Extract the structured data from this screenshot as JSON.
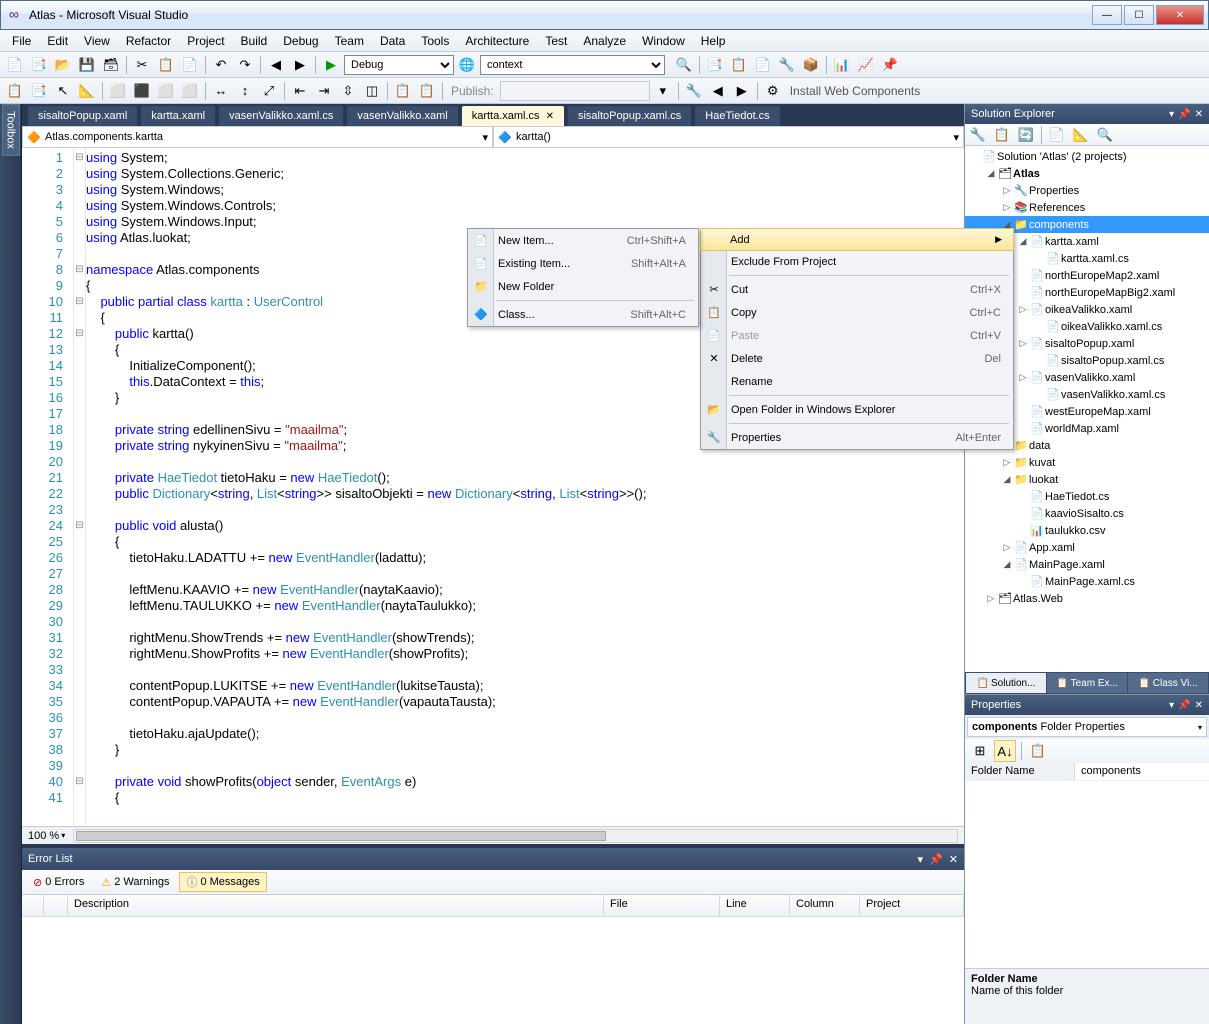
{
  "title": "Atlas - Microsoft Visual Studio",
  "menubar": [
    "File",
    "Edit",
    "View",
    "Refactor",
    "Project",
    "Build",
    "Debug",
    "Team",
    "Data",
    "Tools",
    "Architecture",
    "Test",
    "Analyze",
    "Window",
    "Help"
  ],
  "toolbar1": {
    "debug_config": "Debug",
    "context": "context"
  },
  "toolbar2": {
    "publish_label": "Publish:",
    "install_label": "Install Web Components"
  },
  "left_tab": "Toolbox",
  "doc_tabs": [
    {
      "label": "sisaltoPopup.xaml",
      "active": false
    },
    {
      "label": "kartta.xaml",
      "active": false
    },
    {
      "label": "vasenValikko.xaml.cs",
      "active": false
    },
    {
      "label": "vasenValikko.xaml",
      "active": false
    },
    {
      "label": "kartta.xaml.cs",
      "active": true
    },
    {
      "label": "sisaltoPopup.xaml.cs",
      "active": false
    },
    {
      "label": "HaeTiedot.cs",
      "active": false
    }
  ],
  "nav": {
    "left": "Atlas.components.kartta",
    "right": "kartta()"
  },
  "zoom": "100 %",
  "code_lines": [
    {
      "n": 1,
      "o": "⊟",
      "t": [
        [
          "kw",
          "using"
        ],
        [
          "",
          " System;"
        ]
      ]
    },
    {
      "n": 2,
      "o": "",
      "t": [
        [
          "kw",
          "using"
        ],
        [
          "",
          " System.Collections.Generic;"
        ]
      ]
    },
    {
      "n": 3,
      "o": "",
      "t": [
        [
          "kw",
          "using"
        ],
        [
          "",
          " System.Windows;"
        ]
      ]
    },
    {
      "n": 4,
      "o": "",
      "t": [
        [
          "kw",
          "using"
        ],
        [
          "",
          " System.Windows.Controls;"
        ]
      ]
    },
    {
      "n": 5,
      "o": "",
      "t": [
        [
          "kw",
          "using"
        ],
        [
          "",
          " System.Windows.Input;"
        ]
      ]
    },
    {
      "n": 6,
      "o": "",
      "t": [
        [
          "kw",
          "using"
        ],
        [
          "",
          " Atlas.luokat;"
        ]
      ]
    },
    {
      "n": 7,
      "o": "",
      "t": [
        [
          "",
          ""
        ]
      ]
    },
    {
      "n": 8,
      "o": "⊟",
      "t": [
        [
          "kw",
          "namespace"
        ],
        [
          "",
          " Atlas.components"
        ]
      ]
    },
    {
      "n": 9,
      "o": "",
      "t": [
        [
          "",
          "{"
        ]
      ]
    },
    {
      "n": 10,
      "o": "⊟",
      "t": [
        [
          "",
          "    "
        ],
        [
          "kw",
          "public"
        ],
        [
          "",
          " "
        ],
        [
          "kw",
          "partial"
        ],
        [
          "",
          " "
        ],
        [
          "kw",
          "class"
        ],
        [
          "",
          " "
        ],
        [
          "type",
          "kartta"
        ],
        [
          "",
          " : "
        ],
        [
          "type",
          "UserControl"
        ]
      ]
    },
    {
      "n": 11,
      "o": "",
      "t": [
        [
          "",
          "    {"
        ]
      ]
    },
    {
      "n": 12,
      "o": "⊟",
      "t": [
        [
          "",
          "        "
        ],
        [
          "kw",
          "public"
        ],
        [
          "",
          " kartta()"
        ]
      ]
    },
    {
      "n": 13,
      "o": "",
      "t": [
        [
          "",
          "        {"
        ]
      ]
    },
    {
      "n": 14,
      "o": "",
      "t": [
        [
          "",
          "            InitializeComponent();"
        ]
      ]
    },
    {
      "n": 15,
      "o": "",
      "t": [
        [
          "",
          "            "
        ],
        [
          "kw",
          "this"
        ],
        [
          "",
          ".DataContext = "
        ],
        [
          "kw",
          "this"
        ],
        [
          "",
          ";"
        ]
      ]
    },
    {
      "n": 16,
      "o": "",
      "t": [
        [
          "",
          "        }"
        ]
      ]
    },
    {
      "n": 17,
      "o": "",
      "t": [
        [
          "",
          ""
        ]
      ]
    },
    {
      "n": 18,
      "o": "",
      "t": [
        [
          "",
          "        "
        ],
        [
          "kw",
          "private"
        ],
        [
          "",
          " "
        ],
        [
          "kw",
          "string"
        ],
        [
          "",
          " edellinenSivu = "
        ],
        [
          "str",
          "\"maailma\""
        ],
        [
          "",
          ";"
        ]
      ]
    },
    {
      "n": 19,
      "o": "",
      "t": [
        [
          "",
          "        "
        ],
        [
          "kw",
          "private"
        ],
        [
          "",
          " "
        ],
        [
          "kw",
          "string"
        ],
        [
          "",
          " nykyinenSivu = "
        ],
        [
          "str",
          "\"maailma\""
        ],
        [
          "",
          ";"
        ]
      ]
    },
    {
      "n": 20,
      "o": "",
      "t": [
        [
          "",
          ""
        ]
      ]
    },
    {
      "n": 21,
      "o": "",
      "t": [
        [
          "",
          "        "
        ],
        [
          "kw",
          "private"
        ],
        [
          "",
          " "
        ],
        [
          "type",
          "HaeTiedot"
        ],
        [
          "",
          " tietoHaku = "
        ],
        [
          "kw",
          "new"
        ],
        [
          "",
          " "
        ],
        [
          "type",
          "HaeTiedot"
        ],
        [
          "",
          "();"
        ]
      ]
    },
    {
      "n": 22,
      "o": "",
      "t": [
        [
          "",
          "        "
        ],
        [
          "kw",
          "public"
        ],
        [
          "",
          " "
        ],
        [
          "type",
          "Dictionary"
        ],
        [
          "",
          "<"
        ],
        [
          "kw",
          "string"
        ],
        [
          "",
          ", "
        ],
        [
          "type",
          "List"
        ],
        [
          "",
          "<"
        ],
        [
          "kw",
          "string"
        ],
        [
          "",
          ">> sisaltoObjekti = "
        ],
        [
          "kw",
          "new"
        ],
        [
          "",
          " "
        ],
        [
          "type",
          "Dictionary"
        ],
        [
          "",
          "<"
        ],
        [
          "kw",
          "string"
        ],
        [
          "",
          ", "
        ],
        [
          "type",
          "List"
        ],
        [
          "",
          "<"
        ],
        [
          "kw",
          "string"
        ],
        [
          "",
          ">>();"
        ]
      ]
    },
    {
      "n": 23,
      "o": "",
      "t": [
        [
          "",
          ""
        ]
      ]
    },
    {
      "n": 24,
      "o": "⊟",
      "t": [
        [
          "",
          "        "
        ],
        [
          "kw",
          "public"
        ],
        [
          "",
          " "
        ],
        [
          "kw",
          "void"
        ],
        [
          "",
          " alusta()"
        ]
      ]
    },
    {
      "n": 25,
      "o": "",
      "t": [
        [
          "",
          "        {"
        ]
      ]
    },
    {
      "n": 26,
      "o": "",
      "t": [
        [
          "",
          "            tietoHaku.LADATTU += "
        ],
        [
          "kw",
          "new"
        ],
        [
          "",
          " "
        ],
        [
          "type",
          "EventHandler"
        ],
        [
          "",
          "(ladattu);"
        ]
      ]
    },
    {
      "n": 27,
      "o": "",
      "t": [
        [
          "",
          ""
        ]
      ]
    },
    {
      "n": 28,
      "o": "",
      "t": [
        [
          "",
          "            leftMenu.KAAVIO += "
        ],
        [
          "kw",
          "new"
        ],
        [
          "",
          " "
        ],
        [
          "type",
          "EventHandler"
        ],
        [
          "",
          "(naytaKaavio);"
        ]
      ]
    },
    {
      "n": 29,
      "o": "",
      "t": [
        [
          "",
          "            leftMenu.TAULUKKO += "
        ],
        [
          "kw",
          "new"
        ],
        [
          "",
          " "
        ],
        [
          "type",
          "EventHandler"
        ],
        [
          "",
          "(naytaTaulukko);"
        ]
      ]
    },
    {
      "n": 30,
      "o": "",
      "t": [
        [
          "",
          ""
        ]
      ]
    },
    {
      "n": 31,
      "o": "",
      "t": [
        [
          "",
          "            rightMenu.ShowTrends += "
        ],
        [
          "kw",
          "new"
        ],
        [
          "",
          " "
        ],
        [
          "type",
          "EventHandler"
        ],
        [
          "",
          "(showTrends);"
        ]
      ]
    },
    {
      "n": 32,
      "o": "",
      "t": [
        [
          "",
          "            rightMenu.ShowProfits += "
        ],
        [
          "kw",
          "new"
        ],
        [
          "",
          " "
        ],
        [
          "type",
          "EventHandler"
        ],
        [
          "",
          "(showProfits);"
        ]
      ]
    },
    {
      "n": 33,
      "o": "",
      "t": [
        [
          "",
          ""
        ]
      ]
    },
    {
      "n": 34,
      "o": "",
      "t": [
        [
          "",
          "            contentPopup.LUKITSE += "
        ],
        [
          "kw",
          "new"
        ],
        [
          "",
          " "
        ],
        [
          "type",
          "EventHandler"
        ],
        [
          "",
          "(lukitseTausta);"
        ]
      ]
    },
    {
      "n": 35,
      "o": "",
      "t": [
        [
          "",
          "            contentPopup.VAPAUTA += "
        ],
        [
          "kw",
          "new"
        ],
        [
          "",
          " "
        ],
        [
          "type",
          "EventHandler"
        ],
        [
          "",
          "(vapautaTausta);"
        ]
      ]
    },
    {
      "n": 36,
      "o": "",
      "t": [
        [
          "",
          ""
        ]
      ]
    },
    {
      "n": 37,
      "o": "",
      "t": [
        [
          "",
          "            tietoHaku.ajaUpdate();"
        ]
      ]
    },
    {
      "n": 38,
      "o": "",
      "t": [
        [
          "",
          "        }"
        ]
      ]
    },
    {
      "n": 39,
      "o": "",
      "t": [
        [
          "",
          ""
        ]
      ]
    },
    {
      "n": 40,
      "o": "⊟",
      "t": [
        [
          "",
          "        "
        ],
        [
          "kw",
          "private"
        ],
        [
          "",
          " "
        ],
        [
          "kw",
          "void"
        ],
        [
          "",
          " showProfits("
        ],
        [
          "kw",
          "object"
        ],
        [
          "",
          " sender, "
        ],
        [
          "type",
          "EventArgs"
        ],
        [
          "",
          " e)"
        ]
      ]
    },
    {
      "n": 41,
      "o": "",
      "t": [
        [
          "",
          "        {"
        ]
      ]
    }
  ],
  "error_panel": {
    "title": "Error List",
    "filters": {
      "errors": "0 Errors",
      "warnings": "2 Warnings",
      "messages": "0 Messages"
    },
    "columns": [
      "Description",
      "File",
      "Line",
      "Column",
      "Project"
    ]
  },
  "sol_exp": {
    "title": "Solution Explorer",
    "tree": [
      {
        "d": 0,
        "exp": "",
        "ico": "📄",
        "label": "Solution 'Atlas' (2 projects)"
      },
      {
        "d": 1,
        "exp": "◢",
        "ico": "🗂",
        "label": "Atlas",
        "bold": true
      },
      {
        "d": 2,
        "exp": "▷",
        "ico": "🔧",
        "label": "Properties"
      },
      {
        "d": 2,
        "exp": "▷",
        "ico": "📚",
        "label": "References"
      },
      {
        "d": 2,
        "exp": "◢",
        "ico": "📁",
        "label": "components",
        "sel": true
      },
      {
        "d": 3,
        "exp": "◢",
        "ico": "📄",
        "label": "kartta.xaml"
      },
      {
        "d": 4,
        "exp": "",
        "ico": "📄",
        "label": "kartta.xaml.cs"
      },
      {
        "d": 3,
        "exp": "",
        "ico": "📄",
        "label": "northEuropeMap2.xaml"
      },
      {
        "d": 3,
        "exp": "",
        "ico": "📄",
        "label": "northEuropeMapBig2.xaml"
      },
      {
        "d": 3,
        "exp": "▷",
        "ico": "📄",
        "label": "oikeaValikko.xaml"
      },
      {
        "d": 4,
        "exp": "",
        "ico": "📄",
        "label": "oikeaValikko.xaml.cs"
      },
      {
        "d": 3,
        "exp": "▷",
        "ico": "📄",
        "label": "sisaltoPopup.xaml"
      },
      {
        "d": 4,
        "exp": "",
        "ico": "📄",
        "label": "sisaltoPopup.xaml.cs"
      },
      {
        "d": 3,
        "exp": "▷",
        "ico": "📄",
        "label": "vasenValikko.xaml"
      },
      {
        "d": 4,
        "exp": "",
        "ico": "📄",
        "label": "vasenValikko.xaml.cs"
      },
      {
        "d": 3,
        "exp": "",
        "ico": "📄",
        "label": "westEuropeMap.xaml"
      },
      {
        "d": 3,
        "exp": "",
        "ico": "📄",
        "label": "worldMap.xaml"
      },
      {
        "d": 2,
        "exp": "▷",
        "ico": "📁",
        "label": "data"
      },
      {
        "d": 2,
        "exp": "▷",
        "ico": "📁",
        "label": "kuvat"
      },
      {
        "d": 2,
        "exp": "◢",
        "ico": "📁",
        "label": "luokat"
      },
      {
        "d": 3,
        "exp": "",
        "ico": "📄",
        "label": "HaeTiedot.cs"
      },
      {
        "d": 3,
        "exp": "",
        "ico": "📄",
        "label": "kaavioSisalto.cs"
      },
      {
        "d": 3,
        "exp": "",
        "ico": "📊",
        "label": "taulukko.csv"
      },
      {
        "d": 2,
        "exp": "▷",
        "ico": "📄",
        "label": "App.xaml"
      },
      {
        "d": 2,
        "exp": "◢",
        "ico": "📄",
        "label": "MainPage.xaml"
      },
      {
        "d": 3,
        "exp": "",
        "ico": "📄",
        "label": "MainPage.xaml.cs"
      },
      {
        "d": 1,
        "exp": "▷",
        "ico": "🗂",
        "label": "Atlas.Web"
      }
    ],
    "tabs": [
      "Solution...",
      "Team Ex...",
      "Class Vi..."
    ]
  },
  "props": {
    "title": "Properties",
    "selector_name": "components",
    "selector_type": "Folder Properties",
    "rows": [
      {
        "name": "Folder Name",
        "val": "components"
      }
    ],
    "desc_name": "Folder Name",
    "desc_text": "Name of this folder"
  },
  "context_menu": {
    "items": [
      {
        "ico": "",
        "label": "Add",
        "sub": true,
        "hover": true
      },
      {
        "ico": "",
        "label": "Exclude From Project"
      },
      {
        "sep": true
      },
      {
        "ico": "✂",
        "label": "Cut",
        "shortcut": "Ctrl+X"
      },
      {
        "ico": "📋",
        "label": "Copy",
        "shortcut": "Ctrl+C"
      },
      {
        "ico": "📄",
        "label": "Paste",
        "shortcut": "Ctrl+V",
        "disabled": true
      },
      {
        "ico": "✕",
        "label": "Delete",
        "shortcut": "Del"
      },
      {
        "ico": "",
        "label": "Rename"
      },
      {
        "sep": true
      },
      {
        "ico": "📂",
        "label": "Open Folder in Windows Explorer"
      },
      {
        "sep": true
      },
      {
        "ico": "🔧",
        "label": "Properties",
        "shortcut": "Alt+Enter"
      }
    ]
  },
  "add_submenu": {
    "items": [
      {
        "ico": "📄",
        "label": "New Item...",
        "shortcut": "Ctrl+Shift+A"
      },
      {
        "ico": "📄",
        "label": "Existing Item...",
        "shortcut": "Shift+Alt+A"
      },
      {
        "ico": "📁",
        "label": "New Folder"
      },
      {
        "sep": true
      },
      {
        "ico": "🔷",
        "label": "Class...",
        "shortcut": "Shift+Alt+C"
      }
    ]
  }
}
